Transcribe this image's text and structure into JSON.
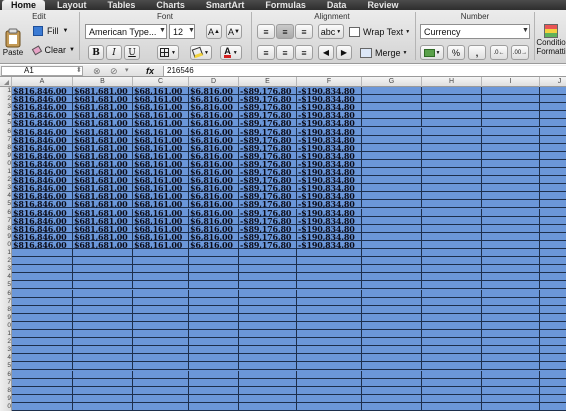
{
  "tabs": [
    "Home",
    "Layout",
    "Tables",
    "Charts",
    "SmartArt",
    "Formulas",
    "Data",
    "Review"
  ],
  "active_tab": "Home",
  "ribbon": {
    "groups": {
      "edit": "Edit",
      "font": "Font",
      "alignment": "Alignment",
      "number": "Number"
    },
    "paste_label": "Paste",
    "fill_label": "Fill",
    "clear_label": "Clear",
    "font_name": "American Type...",
    "font_size": "12",
    "bold": "B",
    "italic": "I",
    "underline": "U",
    "font_grow": "A",
    "font_shrink": "A",
    "wrap_text_label": "Wrap Text",
    "merge_label": "Merge",
    "abc_label": "abc",
    "number_format": "Currency",
    "percent": "%",
    "comma": ",",
    "conditional_label_1": "Conditio",
    "conditional_label_2": "Formatti"
  },
  "formula_bar": {
    "cell_ref": "A1",
    "fx": "fx",
    "content": "216546"
  },
  "columns": [
    "A",
    "B",
    "C",
    "D",
    "E",
    "F",
    "G",
    "H",
    "I",
    "J"
  ],
  "row_numbers": [
    "1",
    "2",
    "3",
    "4",
    "5",
    "6",
    "7",
    "8",
    "9",
    "0",
    "1",
    "2",
    "3",
    "4",
    "5",
    "6",
    "7",
    "8",
    "9",
    "0",
    "1",
    "2",
    "3",
    "4",
    "5",
    "6",
    "7",
    "8",
    "9",
    "0",
    "1",
    "2",
    "3",
    "4",
    "5",
    "6",
    "7",
    "8",
    "9",
    "0"
  ],
  "data_row_count": 20,
  "row_values": [
    "$816,846.00",
    "$681,681.00",
    "$68,161.00",
    "$6,816.00",
    "-$89,176.80",
    "-$190,834.80"
  ],
  "colors": {
    "cell_fill": "#6b97d9",
    "grid_line": "#1d2f4c",
    "ribbon": "#dcdcdc",
    "tabbar": "#3a3a3a"
  }
}
